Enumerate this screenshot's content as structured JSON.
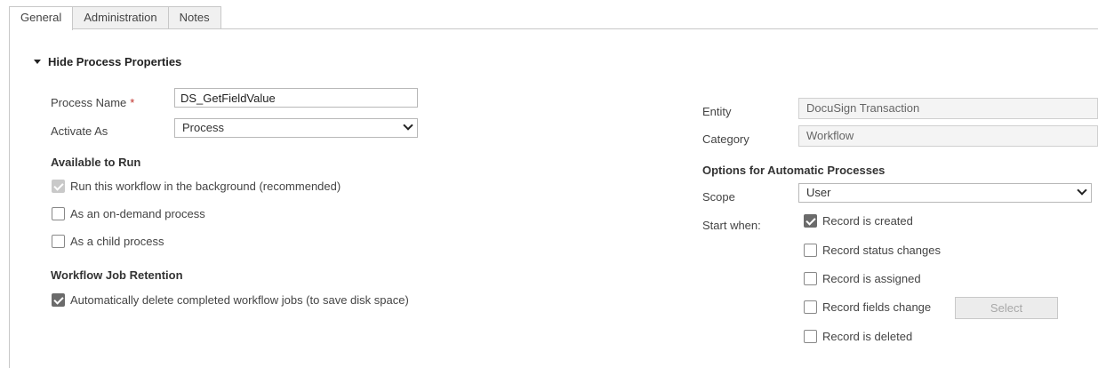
{
  "tabs": [
    {
      "label": "General"
    },
    {
      "label": "Administration"
    },
    {
      "label": "Notes"
    }
  ],
  "section": {
    "title": "Hide Process Properties"
  },
  "left": {
    "process_name_label": "Process Name",
    "required_mark": "*",
    "process_name_value": "DS_GetFieldValue",
    "activate_as_label": "Activate As",
    "activate_as_value": "Process",
    "available_title": "Available to Run",
    "run_background_label": "Run this workflow in the background (recommended)",
    "on_demand_label": "As an on-demand process",
    "child_process_label": "As a child process",
    "retention_title": "Workflow Job Retention",
    "auto_delete_label": "Automatically delete completed workflow jobs (to save disk space)"
  },
  "right": {
    "entity_label": "Entity",
    "entity_value": "DocuSign Transaction",
    "category_label": "Category",
    "category_value": "Workflow",
    "options_title": "Options for Automatic Processes",
    "scope_label": "Scope",
    "scope_value": "User",
    "start_when_label": "Start when:",
    "record_created_label": "Record is created",
    "record_status_label": "Record status changes",
    "record_assigned_label": "Record is assigned",
    "record_fields_label": "Record fields change",
    "select_button_label": "Select",
    "record_deleted_label": "Record is deleted"
  },
  "checkbox_states": {
    "run_background": "checked-disabled",
    "on_demand": "unchecked",
    "child_process": "unchecked",
    "auto_delete": "checked",
    "record_created": "checked",
    "record_status": "unchecked",
    "record_assigned": "unchecked",
    "record_fields": "unchecked",
    "record_deleted": "unchecked"
  },
  "colors": {
    "required": "#c0312b",
    "checkbox_checked": "#6b6b6b",
    "checkbox_disabled": "#c9c9c9",
    "border": "#c8c8c8"
  }
}
